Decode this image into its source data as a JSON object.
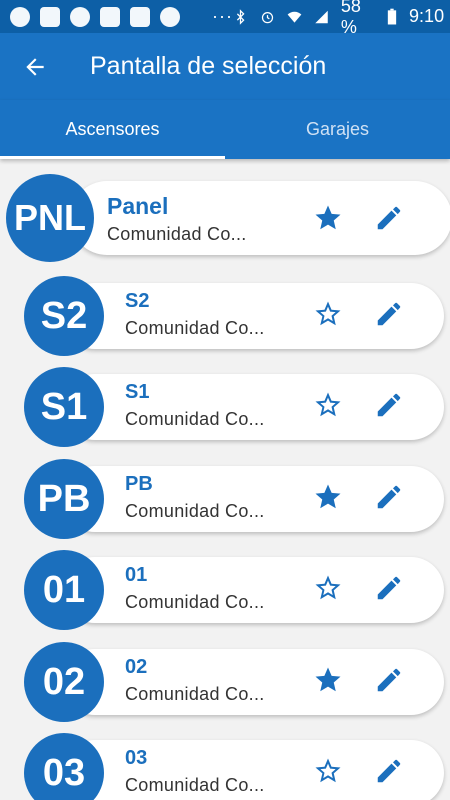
{
  "status_bar": {
    "battery": "58 %",
    "time": "9:10",
    "dots": "···"
  },
  "appbar": {
    "title": "Pantalla de selección"
  },
  "tabs": [
    {
      "label": "Ascensores",
      "active": true
    },
    {
      "label": "Garajes",
      "active": false
    }
  ],
  "items": [
    {
      "badge": "PNL",
      "name": "Panel",
      "subtitle": "Comunidad Co...",
      "favorite": true
    },
    {
      "badge": "S2",
      "name": "S2",
      "subtitle": "Comunidad Co...",
      "favorite": false
    },
    {
      "badge": "S1",
      "name": "S1",
      "subtitle": "Comunidad Co...",
      "favorite": false
    },
    {
      "badge": "PB",
      "name": "PB",
      "subtitle": "Comunidad Co...",
      "favorite": true
    },
    {
      "badge": "01",
      "name": "01",
      "subtitle": "Comunidad Co...",
      "favorite": false
    },
    {
      "badge": "02",
      "name": "02",
      "subtitle": "Comunidad Co...",
      "favorite": true
    },
    {
      "badge": "03",
      "name": "03",
      "subtitle": "Comunidad Co...",
      "favorite": false
    }
  ],
  "colors": {
    "primary": "#1a73c4",
    "status_bar": "#0d5fa6",
    "badge": "#1b6fbd"
  }
}
